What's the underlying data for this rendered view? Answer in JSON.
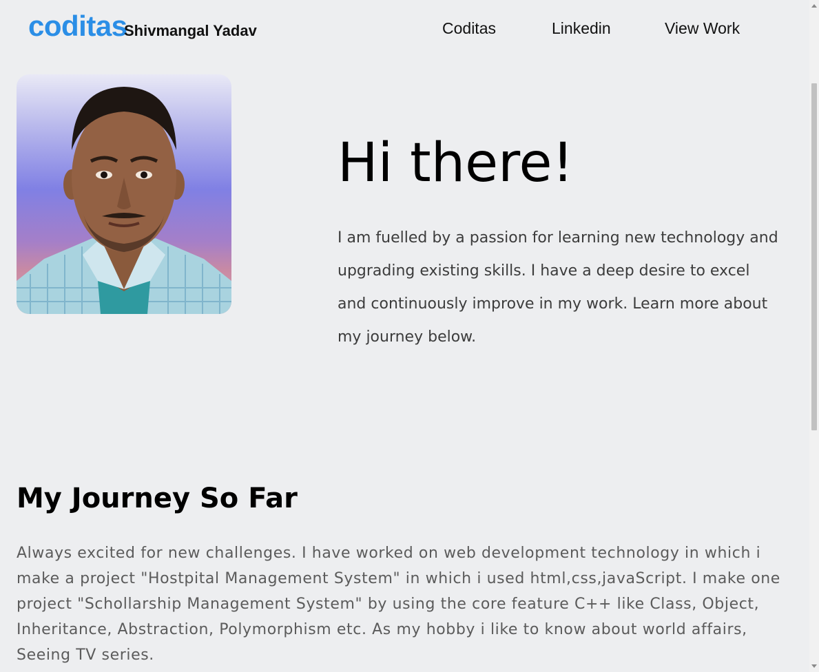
{
  "header": {
    "logo_text": "coditas",
    "owner_name": "Shivmangal Yadav",
    "nav": [
      {
        "label": "Coditas"
      },
      {
        "label": "Linkedin"
      },
      {
        "label": "View Work"
      }
    ]
  },
  "hero": {
    "title": "Hi there!",
    "text": "I am fuelled by a passion for learning new technology and upgrading existing skills. I have a deep desire to excel and continuously improve in my work. Learn more about my journey below."
  },
  "journey": {
    "title": "My Journey So Far",
    "text": "Always excited for new challenges. I have worked on web development technology in which i make a project \"Hostpital Management System\" in which i used html,css,javaScript. I make one project \"Schollarship Management System\" by using the core feature C++ like Class, Object, Inheritance, Abstraction, Polymorphism etc. As my hobby i like to know about world affairs, Seeing TV series."
  },
  "colors": {
    "background": "#edeef0",
    "brand": "#2b8ee6",
    "body_text": "#3c3c3c",
    "muted_text": "#5b5b5b"
  },
  "icons": {
    "portrait": "profile-photo"
  }
}
